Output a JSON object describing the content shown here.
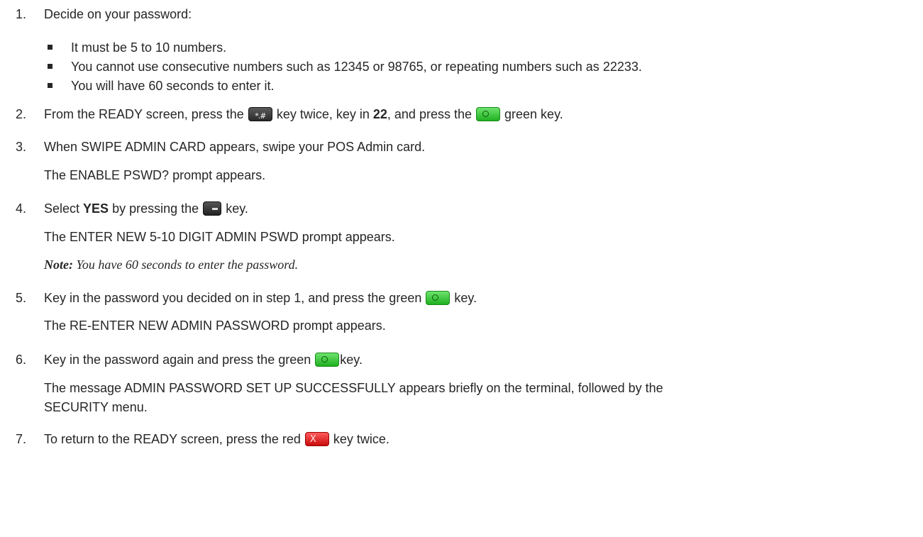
{
  "steps": [
    {
      "number": "1.",
      "text": "Decide on your password:"
    },
    {
      "number": "2.",
      "parts": {
        "a": "From the READY screen, press the",
        "b": "key twice, key in",
        "bold": "22",
        "c": ", and press the",
        "d": "green key."
      }
    },
    {
      "number": "3.",
      "text": "When SWIPE ADMIN CARD appears, swipe your POS Admin card.",
      "result": "The ENABLE PSWD? prompt appears."
    },
    {
      "number": "4.",
      "parts": {
        "a": "Select",
        "bold": "YES",
        "b": "by pressing the",
        "c": "key."
      },
      "result": "The ENTER NEW 5-10 DIGIT ADMIN PSWD prompt appears.",
      "note_label": "Note:",
      "note_text": "You have 60 seconds to enter the password."
    },
    {
      "number": "5.",
      "parts": {
        "a": "Key in the password you decided on in step 1, and press the green",
        "b": "key."
      },
      "result": "The RE-ENTER NEW ADMIN PASSWORD prompt appears."
    },
    {
      "number": "6.",
      "parts": {
        "a": "Key in the password again and press the green",
        "b": "key."
      },
      "result_line1": "The message ADMIN PASSWORD SET UP SUCCESSFULLY appears briefly on the terminal, followed by the",
      "result_line2": "SECURITY menu."
    },
    {
      "number": "7.",
      "parts": {
        "a": "To return to the READY screen, press the red",
        "b": "key twice."
      }
    }
  ],
  "bullets": [
    "It must be 5 to 10 numbers.",
    "You cannot use consecutive numbers such as 12345 or 98765, or repeating numbers such as 22233.",
    "You will have 60 seconds to enter it."
  ],
  "icons": {
    "hash_key": "hash-key-icon",
    "green_key": "green-key-icon",
    "select_key": "select-key-icon",
    "red_key": "red-key-icon"
  },
  "colors": {
    "text": "#262626",
    "green_key": "#20b020",
    "red_key": "#c80c0c",
    "dark_key": "#2a2a2a"
  }
}
